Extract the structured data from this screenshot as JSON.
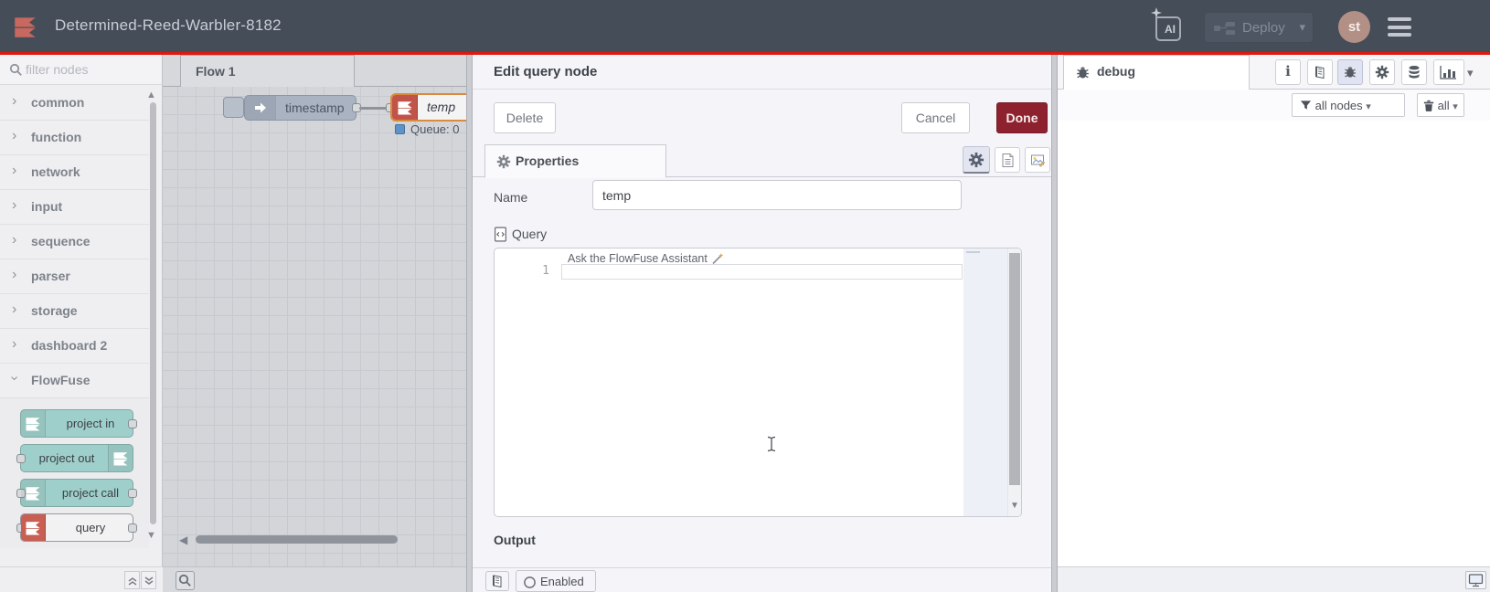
{
  "header": {
    "title": "Determined-Reed-Warbler-8182",
    "ai_label": "AI",
    "deploy_label": "Deploy",
    "avatar_initials": "st"
  },
  "palette": {
    "filter_placeholder": "filter nodes",
    "categories": [
      "common",
      "function",
      "network",
      "input",
      "sequence",
      "parser",
      "storage",
      "dashboard 2"
    ],
    "flowfuse_label": "FlowFuse",
    "nodes": [
      "project in",
      "project out",
      "project call",
      "query"
    ]
  },
  "canvas": {
    "tab_label": "Flow 1",
    "inject_node_label": "timestamp",
    "query_node_label": "temp",
    "queue_status": "Queue: 0"
  },
  "tray": {
    "title": "Edit query node",
    "delete_label": "Delete",
    "cancel_label": "Cancel",
    "done_label": "Done",
    "properties_tab": "Properties",
    "name_label": "Name",
    "name_value": "temp",
    "query_label": "Query",
    "assistant_placeholder": "Ask the FlowFuse Assistant",
    "line_number": "1",
    "output_label": "Output",
    "enabled_label": "Enabled"
  },
  "sidebar": {
    "tab_label": "debug",
    "filter_all_nodes": "all nodes",
    "clear_all": "all"
  },
  "icons": {
    "chevron_right": "›",
    "caret_down": "▾",
    "triangle_up": "▲",
    "triangle_down": "▼",
    "triangle_left": "◀",
    "info": "i"
  },
  "colors": {
    "header_bg": "#454d59",
    "header_red_border": "#e0190f",
    "accent_red_done": "#8d222e",
    "flowfuse_logo_red": "#c9685f",
    "node_teal": "#9fcfca",
    "query_icon_red": "#c05449",
    "selected_node_orange": "#d98b3b",
    "inject_node_gray_blue": "#a9b3c2",
    "status_dot_blue": "#5e93c9",
    "tray_bg": "#f5f5f9"
  }
}
